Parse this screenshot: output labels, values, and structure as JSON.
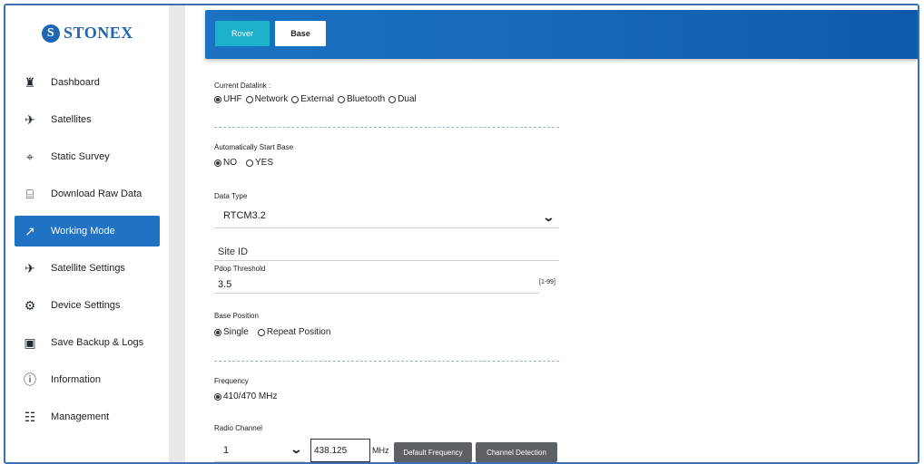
{
  "brand": {
    "logo_text": "STONEX",
    "logo_mark": "S"
  },
  "sidebar": {
    "items": [
      {
        "label": "Dashboard",
        "icon": "home-icon",
        "glyph": "♜"
      },
      {
        "label": "Satellites",
        "icon": "satellite-icon",
        "glyph": "✈"
      },
      {
        "label": "Static Survey",
        "icon": "location-pin-icon",
        "glyph": "⌖"
      },
      {
        "label": "Download Raw Data",
        "icon": "download-icon",
        "glyph": "⌸"
      },
      {
        "label": "Working Mode",
        "icon": "working-mode-icon",
        "glyph": "↗"
      },
      {
        "label": "Satellite Settings",
        "icon": "satellite-settings-icon",
        "glyph": "✈"
      },
      {
        "label": "Device Settings",
        "icon": "device-settings-icon",
        "glyph": "⚙"
      },
      {
        "label": "Save Backup & Logs",
        "icon": "backup-icon",
        "glyph": "▣"
      },
      {
        "label": "Information",
        "icon": "info-icon",
        "glyph": "ⓘ"
      },
      {
        "label": "Management",
        "icon": "management-icon",
        "glyph": "☷"
      }
    ],
    "active_index": 4
  },
  "header": {
    "rover_label": "Rover",
    "base_label": "Base"
  },
  "form": {
    "datalink": {
      "label": "Current Datalink :",
      "options": [
        "UHF",
        "Network",
        "External",
        "Bluetooth",
        "Dual"
      ],
      "selected": "UHF"
    },
    "auto_start": {
      "label": "Automatically Start Base",
      "options": [
        "NO",
        "YES"
      ],
      "selected": "NO"
    },
    "data_type": {
      "label": "Data Type",
      "value": "RTCM3.2"
    },
    "site_id": {
      "placeholder": "Site ID"
    },
    "pdop": {
      "label": "Pdop Threshold",
      "value": "3.5",
      "range": "[1-99]"
    },
    "base_position": {
      "label": "Base Position",
      "options": [
        "Single",
        "Repeat Position"
      ],
      "selected": "Single"
    },
    "frequency": {
      "label": "Frequency",
      "value": "410/470 MHz"
    },
    "radio_channel": {
      "label": "Radio Channel",
      "channel": "1",
      "freq_value": "438.125",
      "unit": "MHz",
      "default_btn": "Default Frequency",
      "detect_btn": "Channel Detection"
    }
  },
  "colors": {
    "accent": "#1f72c4",
    "rover": "#1cb0c9",
    "brand": "#1f66b3"
  }
}
